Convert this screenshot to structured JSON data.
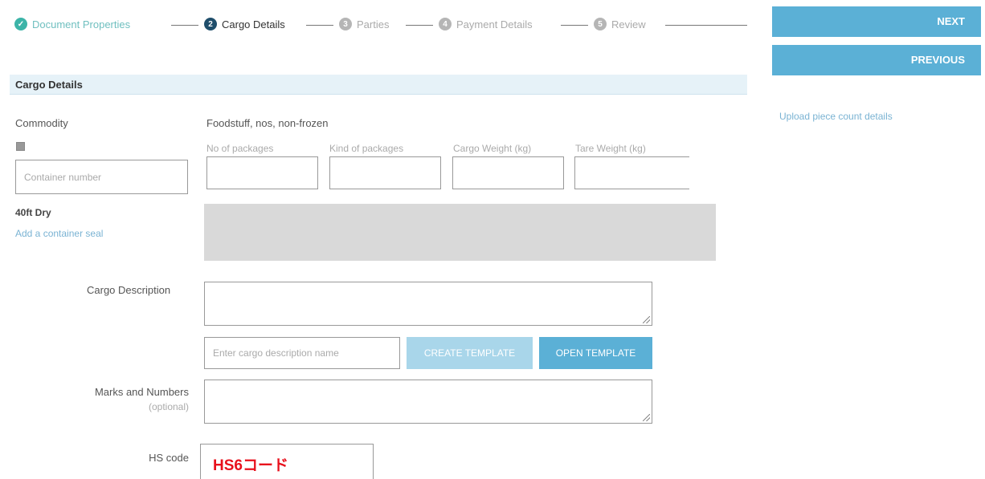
{
  "stepper": {
    "steps": [
      {
        "number": "✓",
        "label": "Document Properties",
        "state": "done"
      },
      {
        "number": "2",
        "label": "Cargo Details",
        "state": "active"
      },
      {
        "number": "3",
        "label": "Parties",
        "state": "pending"
      },
      {
        "number": "4",
        "label": "Payment Details",
        "state": "pending"
      },
      {
        "number": "5",
        "label": "Review",
        "state": "pending"
      }
    ]
  },
  "nav": {
    "next_label": "NEXT",
    "previous_label": "PREVIOUS",
    "upload_link": "Upload piece count details"
  },
  "section": {
    "title": "Cargo Details"
  },
  "commodity": {
    "label": "Commodity",
    "value": "Foodstuff, nos, non-frozen"
  },
  "container": {
    "number_placeholder": "Container number",
    "type": "40ft Dry",
    "add_seal_link": "Add a container seal"
  },
  "packages": {
    "no_of_packages_label": "No of packages",
    "kind_of_packages_label": "Kind of packages",
    "cargo_weight_label": "Cargo Weight (kg)",
    "tare_weight_label": "Tare Weight (kg)"
  },
  "cargo_description": {
    "label": "Cargo Description",
    "name_placeholder": "Enter cargo description name",
    "create_template_label": "CREATE TEMPLATE",
    "open_template_label": "OPEN TEMPLATE"
  },
  "marks": {
    "label": "Marks and Numbers",
    "optional": "(optional)"
  },
  "hs_code": {
    "label": "HS code",
    "value": "HS6コード"
  },
  "colors": {
    "primary_button": "#5bb0d6",
    "disabled_button": "#a9d6ea",
    "done_step": "#3cb4a8",
    "active_step": "#1f4e6b",
    "hs_code_annotation": "#e8101c"
  }
}
